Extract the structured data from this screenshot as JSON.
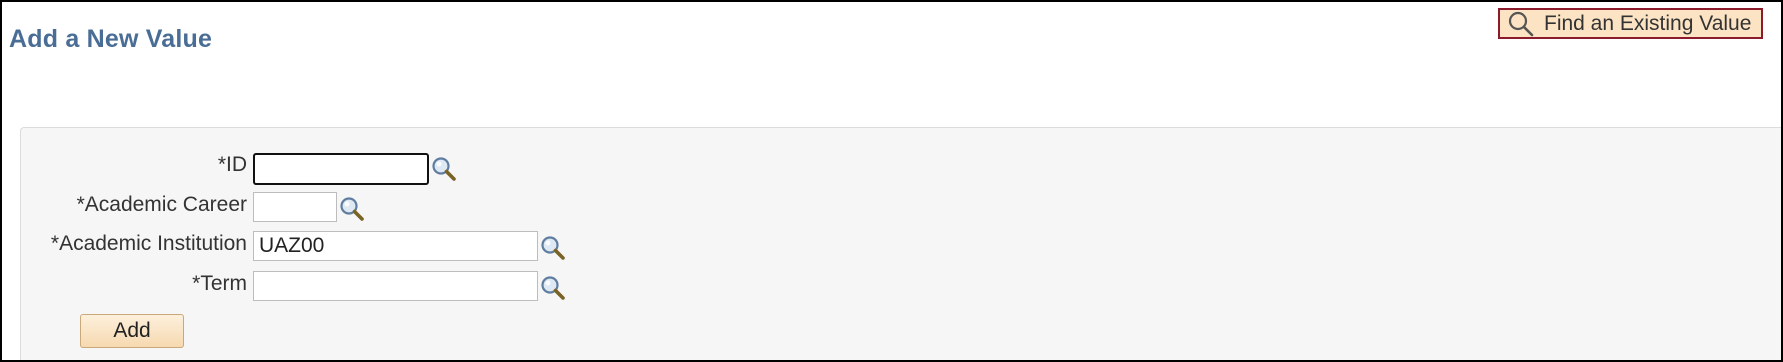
{
  "page_title": "Add a New Value",
  "find_button": {
    "label": "Find an Existing Value",
    "icon": "search-icon"
  },
  "form": {
    "id": {
      "label": "*ID",
      "value": ""
    },
    "academic_career": {
      "label": "*Academic Career",
      "value": ""
    },
    "academic_institution": {
      "label": "*Academic Institution",
      "value": "UAZ00"
    },
    "term": {
      "label": "*Term",
      "value": ""
    }
  },
  "add_button": {
    "label": "Add"
  },
  "colors": {
    "title": "#4a6d96",
    "find_bg": "#fbe3c3",
    "find_border": "#8b1a2c",
    "panel_bg": "#f6f6f6"
  }
}
